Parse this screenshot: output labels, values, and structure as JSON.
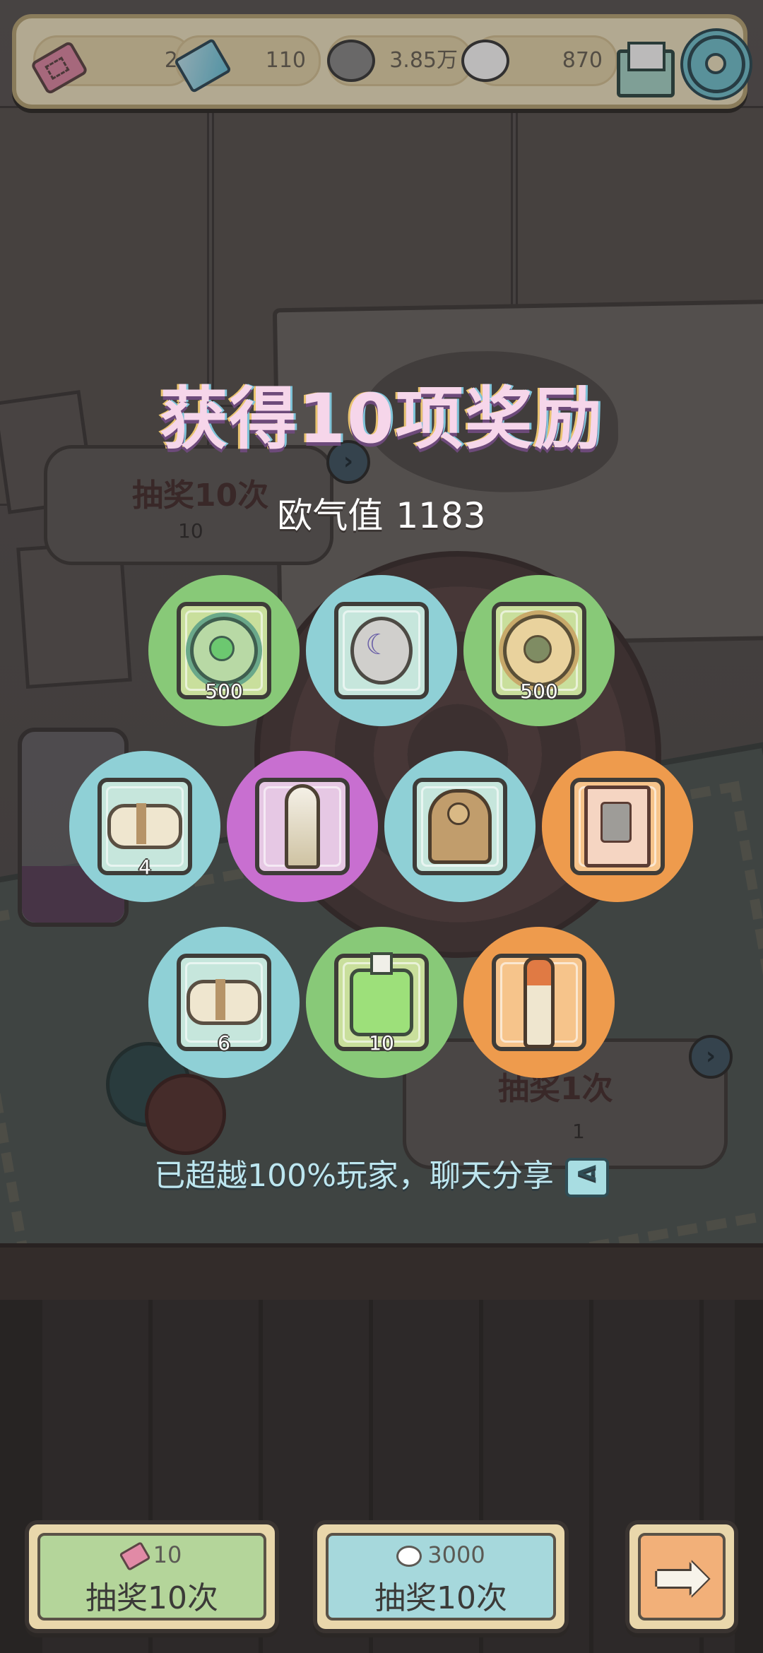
{
  "currencies": {
    "tickets": "2",
    "crystals": "110",
    "gray_bubbles": "3.85万",
    "white_bubbles": "870"
  },
  "background": {
    "draw10": {
      "title": "抽奖10次",
      "cost": "10"
    },
    "draw1": {
      "title": "抽奖1次",
      "cost": "1"
    }
  },
  "popup": {
    "title": "获得10项奖励",
    "luck_label": "欧气值",
    "luck_value": "1183",
    "rewards": [
      {
        "icon": "virus-icon",
        "color": "green",
        "qty": "500"
      },
      {
        "icon": "amulet-icon",
        "color": "blue",
        "qty": ""
      },
      {
        "icon": "sun-medallion-icon",
        "color": "green",
        "qty": "500"
      },
      {
        "icon": "scroll-icon",
        "color": "blue",
        "qty": "4"
      },
      {
        "icon": "horn-icon",
        "color": "purple",
        "qty": ""
      },
      {
        "icon": "statue-icon",
        "color": "blue",
        "qty": ""
      },
      {
        "icon": "portrait-book-icon",
        "color": "orange",
        "qty": ""
      },
      {
        "icon": "scroll-icon",
        "color": "blue",
        "qty": "6"
      },
      {
        "icon": "potion-icon",
        "color": "green",
        "qty": "10"
      },
      {
        "icon": "torch-icon",
        "color": "orange",
        "qty": ""
      }
    ],
    "share_text": "已超越100%玩家，聊天分享"
  },
  "buttons": {
    "draw_ticket": {
      "cost": "10",
      "label": "抽奖10次"
    },
    "draw_bubble": {
      "cost": "3000",
      "label": "抽奖10次"
    }
  }
}
